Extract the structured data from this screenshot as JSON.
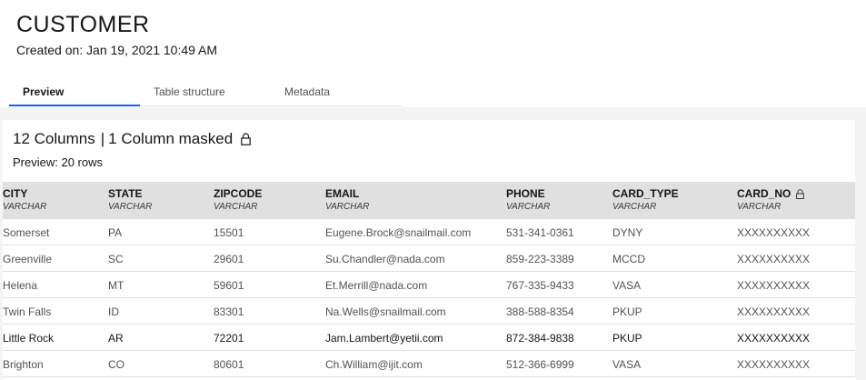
{
  "page": {
    "title": "CUSTOMER",
    "created": "Created on: Jan 19, 2021 10:49 AM"
  },
  "tabs": [
    {
      "label": "Preview",
      "active": true
    },
    {
      "label": "Table structure",
      "active": false
    },
    {
      "label": "Metadata",
      "active": false
    }
  ],
  "summary": {
    "columns": "12 Columns",
    "separator": "|",
    "masked": "1 Column masked",
    "preview_rows": "Preview: 20 rows"
  },
  "table": {
    "columns": [
      {
        "name": "CITY",
        "type": "VARCHAR",
        "masked": false
      },
      {
        "name": "STATE",
        "type": "VARCHAR",
        "masked": false
      },
      {
        "name": "ZIPCODE",
        "type": "VARCHAR",
        "masked": false
      },
      {
        "name": "EMAIL",
        "type": "VARCHAR",
        "masked": false
      },
      {
        "name": "PHONE",
        "type": "VARCHAR",
        "masked": false
      },
      {
        "name": "CARD_TYPE",
        "type": "VARCHAR",
        "masked": false
      },
      {
        "name": "CARD_NO",
        "type": "VARCHAR",
        "masked": true
      }
    ],
    "rows": [
      [
        "Somerset",
        "PA",
        "15501",
        "Eugene.Brock@snailmail.com",
        "531-341-0361",
        "DYNY",
        "XXXXXXXXXX"
      ],
      [
        "Greenville",
        "SC",
        "29601",
        "Su.Chandler@nada.com",
        "859-223-3389",
        "MCCD",
        "XXXXXXXXXX"
      ],
      [
        "Helena",
        "MT",
        "59601",
        "Et.Merrill@nada.com",
        "767-335-9433",
        "VASA",
        "XXXXXXXXXX"
      ],
      [
        "Twin Falls",
        "ID",
        "83301",
        "Na.Wells@snailmail.com",
        "388-588-8354",
        "PKUP",
        "XXXXXXXXXX"
      ],
      [
        "Little Rock",
        "AR",
        "72201",
        "Jam.Lambert@yetii.com",
        "872-384-9838",
        "PKUP",
        "XXXXXXXXXX"
      ],
      [
        "Brighton",
        "CO",
        "80601",
        "Ch.William@ijit.com",
        "512-366-6999",
        "VASA",
        "XXXXXXXXXX"
      ]
    ],
    "highlighted_row": 4
  },
  "icons": {
    "masked_lock": "lock-icon"
  },
  "colors": {
    "accent": "#0f62fe",
    "header_bg": "#e0e0e0",
    "content_bg": "#f4f4f4"
  }
}
